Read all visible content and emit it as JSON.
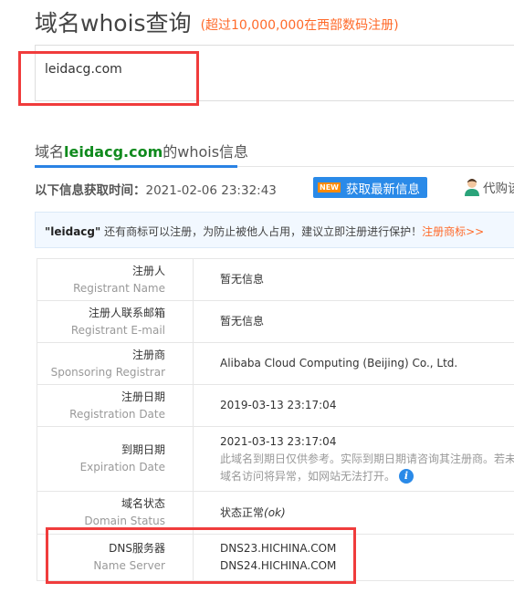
{
  "header": {
    "title": "域名whois查询",
    "subtitle": "(超过10,000,000在西部数码注册)"
  },
  "search": {
    "value": "leidacg.com"
  },
  "tab": {
    "prefix": "域名",
    "domain": "leidacg.com",
    "suffix": "的whois信息"
  },
  "fetch": {
    "label": "以下信息获取时间：",
    "time": "2021-02-06 23:32:43",
    "new_badge": "NEW",
    "button": "获取最新信息",
    "agent": "代购该"
  },
  "notice": {
    "name": "\"leidacg\"",
    "text": " 还有商标可以注册，为防止被他人占用，建议立即注册进行保护！",
    "link": "注册商标>>"
  },
  "rows": [
    {
      "zh": "注册人",
      "en": "Registrant Name",
      "value": "暂无信息"
    },
    {
      "zh": "注册人联系邮箱",
      "en": "Registrant E-mail",
      "value": "暂无信息"
    },
    {
      "zh": "注册商",
      "en": "Sponsoring Registrar",
      "value": "Alibaba Cloud Computing (Beijing) Co., Ltd."
    },
    {
      "zh": "注册日期",
      "en": "Registration Date",
      "value": "2019-03-13 23:17:04"
    },
    {
      "zh": "到期日期",
      "en": "Expiration Date",
      "value": "2021-03-13 23:17:04",
      "note1": "此域名到期日仅供参考。实际到期日期请咨询其注册商。若未",
      "note2": "域名访问将异常，如网站无法打开。"
    },
    {
      "zh": "域名状态",
      "en": "Domain Status",
      "value": "状态正常",
      "status": "(ok)"
    },
    {
      "zh": "DNS服务器",
      "en": "Name Server",
      "value": "DNS23.HICHINA.COM",
      "value2": "DNS24.HICHINA.COM"
    }
  ]
}
